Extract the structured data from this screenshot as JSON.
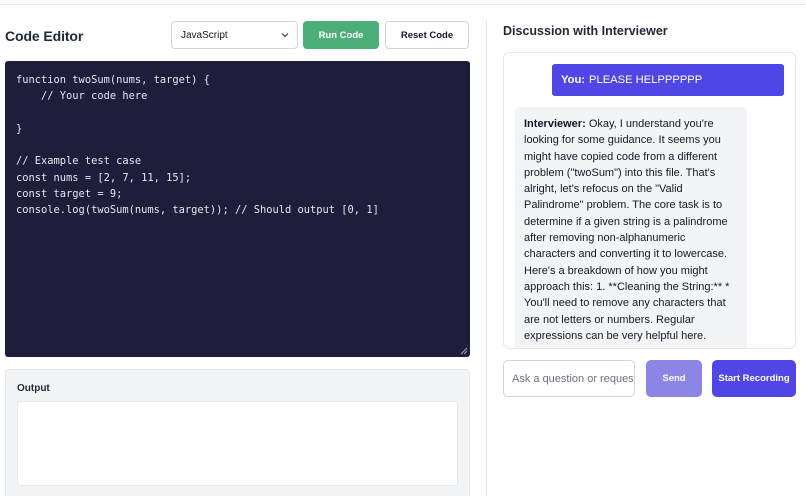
{
  "editor": {
    "title": "Code Editor",
    "language": "JavaScript",
    "run_label": "Run Code",
    "reset_label": "Reset Code",
    "code_lines": [
      "function twoSum(nums, target) {",
      "    // Your code here",
      "",
      "}",
      "",
      "// Example test case",
      "const nums = [2, 7, 11, 15];",
      "const target = 9;",
      "console.log(twoSum(nums, target)); // Should output [0, 1]"
    ]
  },
  "output": {
    "label": "Output",
    "value": ""
  },
  "discussion": {
    "title": "Discussion with Interviewer",
    "messages": [
      {
        "sender": "You:",
        "text": "PLEASE HELPPPPPP"
      },
      {
        "sender": "Interviewer:",
        "text": "Okay, I understand you're looking for some guidance. It seems you might have copied code from a different problem (\"twoSum\") into this file. That's alright, let's refocus on the \"Valid Palindrome\" problem. The core task is to determine if a given string is a palindrome after removing non-alphanumeric characters and converting it to lowercase. Here's a breakdown of how you might approach this: 1. **Cleaning the String:** * You'll need to remove any characters that are not letters or numbers. Regular expressions can be very helpful here."
      }
    ],
    "input_placeholder": "Ask a question or request help...",
    "send_label": "Send",
    "record_label": "Start Recording"
  },
  "colors": {
    "run_button": "#4caf7a",
    "editor_bg": "#1e1e3c",
    "accent": "#4f46e5",
    "send_button": "#8b85e6"
  }
}
